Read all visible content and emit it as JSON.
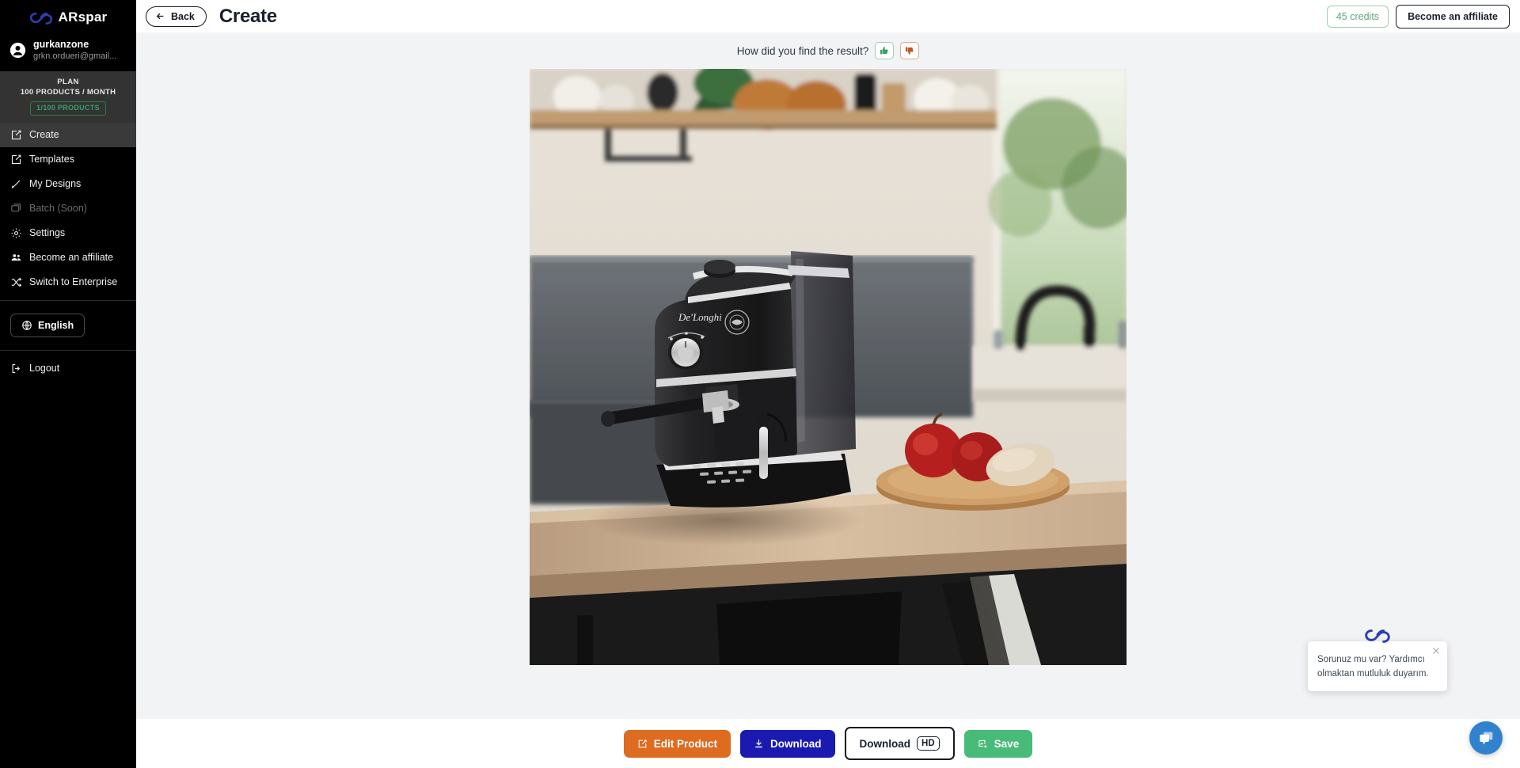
{
  "brand": {
    "name": "ARspar",
    "logo_icon": "infinity-logo-icon",
    "logo_color": "#2b3eb5"
  },
  "sidebar": {
    "user": {
      "avatar_icon": "user-avatar-icon",
      "name": "gurkanzone",
      "email": "grkn.ordueri@gmail..."
    },
    "plan": {
      "label": "PLAN",
      "quota": "100 PRODUCTS / MONTH",
      "usage_badge": "1/100 PRODUCTS",
      "badge_color": "#38a169"
    },
    "items": [
      {
        "label": "Create",
        "icon": "edit-square-icon",
        "active": true,
        "disabled": false
      },
      {
        "label": "Templates",
        "icon": "edit-square-icon",
        "active": false,
        "disabled": false
      },
      {
        "label": "My Designs",
        "icon": "pen-icon",
        "active": false,
        "disabled": false
      },
      {
        "label": "Batch (Soon)",
        "icon": "images-icon",
        "active": false,
        "disabled": true
      },
      {
        "label": "Settings",
        "icon": "gear-icon",
        "active": false,
        "disabled": false
      },
      {
        "label": "Become an affiliate",
        "icon": "people-icon",
        "active": false,
        "disabled": false
      },
      {
        "label": "Switch to Enterprise",
        "icon": "shuffle-icon",
        "active": false,
        "disabled": false
      }
    ],
    "language": {
      "label": "English",
      "icon": "globe-icon"
    },
    "logout": {
      "label": "Logout",
      "icon": "logout-icon"
    }
  },
  "header": {
    "back_label": "Back",
    "back_icon": "arrow-left-icon",
    "title": "Create",
    "credits": "45 credits",
    "affiliate_label": "Become an affiliate"
  },
  "feedback": {
    "question": "How did you find the result?",
    "thumbs_up_icon": "thumbs-up-icon",
    "thumbs_down_icon": "thumbs-down-icon",
    "up_color": "#38a169",
    "down_color": "#c05621"
  },
  "preview": {
    "description": "Black De'Longhi espresso machine on a wooden kitchen counter with apples on a cutting board, plants on a shelf and a window with a black faucet in the background"
  },
  "actions": [
    {
      "label": "Edit Product",
      "icon": "edit-square-icon",
      "color": "#dd6b20"
    },
    {
      "label": "Download",
      "icon": "download-icon",
      "color": "#1a1ab0"
    },
    {
      "label": "Download",
      "badge": "HD",
      "icon": "none",
      "color": "#ffffff"
    },
    {
      "label": "Save",
      "icon": "save-image-icon",
      "color": "#48bb78"
    }
  ],
  "chat": {
    "logo_icon": "infinity-logo-icon",
    "close_icon": "close-icon",
    "message": "Sorunuz mu var? Yardımcı olmaktan mutluluk duyarım.",
    "fab_icon": "chat-bubble-icon",
    "fab_color": "#3182ce"
  }
}
